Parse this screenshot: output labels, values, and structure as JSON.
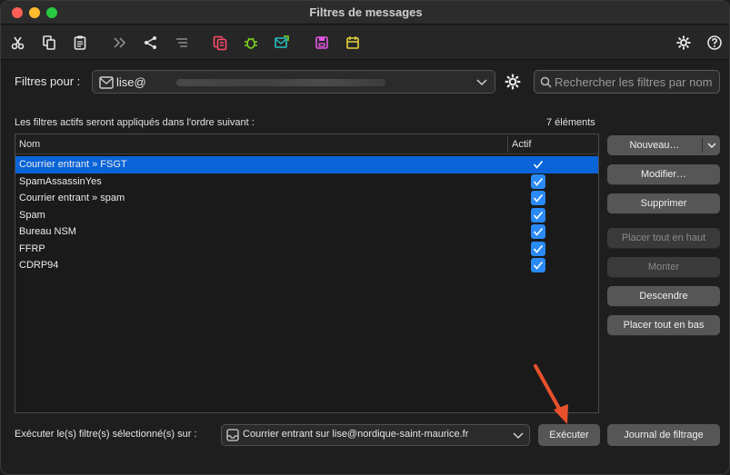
{
  "window": {
    "title": "Filtres de messages"
  },
  "toolbar": {
    "icons": [
      "cut-icon",
      "copy-icon",
      "paste-icon",
      "forward-icon",
      "share-icon",
      "list-icon",
      "copy-to-icon",
      "bug-icon",
      "mail-send-icon",
      "save-icon",
      "folder-icon",
      "settings-icon",
      "help-icon"
    ]
  },
  "filters_for": {
    "label": "Filtres pour :",
    "account_value": "lise@"
  },
  "search": {
    "placeholder": "Rechercher les filtres par nom"
  },
  "list_info": {
    "description": "Les filtres actifs seront appliqués dans l'ordre suivant :",
    "count": "7 éléments"
  },
  "list": {
    "col_name": "Nom",
    "col_active": "Actif",
    "rows": [
      {
        "name": "Courrier entrant » FSGT",
        "active": true,
        "selected": true
      },
      {
        "name": "SpamAssassinYes",
        "active": true
      },
      {
        "name": "Courrier entrant » spam",
        "active": true
      },
      {
        "name": "Spam",
        "active": true
      },
      {
        "name": "Bureau NSM",
        "active": true
      },
      {
        "name": "FFRP",
        "active": true
      },
      {
        "name": "CDRP94",
        "active": true
      }
    ]
  },
  "side_buttons": {
    "new": "Nouveau…",
    "edit": "Modifier…",
    "delete": "Supprimer",
    "top": "Placer tout en haut",
    "up": "Monter",
    "down": "Descendre",
    "bottom": "Placer tout en bas"
  },
  "run": {
    "label": "Exécuter le(s) filtre(s) sélectionné(s) sur :",
    "folder": "Courrier entrant sur lise@nordique-saint-maurice.fr",
    "run_button": "Exécuter",
    "log_button": "Journal de filtrage"
  },
  "colors": {
    "accent": "#0a64d8",
    "checkbox": "#2a8af6",
    "annotation": "#e8502b"
  }
}
